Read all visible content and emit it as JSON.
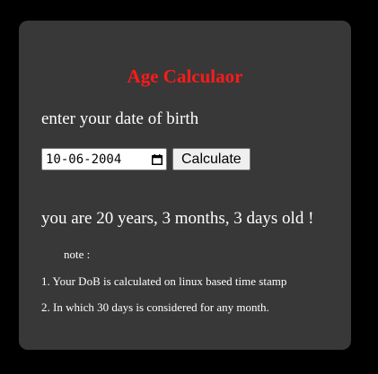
{
  "app": {
    "title": "Age Calculaor",
    "title_color": "#ff1a1a",
    "card_color": "#383838",
    "background_color": "#000000"
  },
  "form": {
    "prompt": "enter your date of birth",
    "date_value": "10-06-2004",
    "calendar_icon": "calendar-icon",
    "button_label": "Calculate"
  },
  "result": {
    "text": "you are 20 years, 3 months, 3 days old !"
  },
  "notes": {
    "label": "note :",
    "items": [
      "1. Your DoB is calculated on linux based time stamp",
      "2. In which 30 days is considered for any month."
    ]
  }
}
